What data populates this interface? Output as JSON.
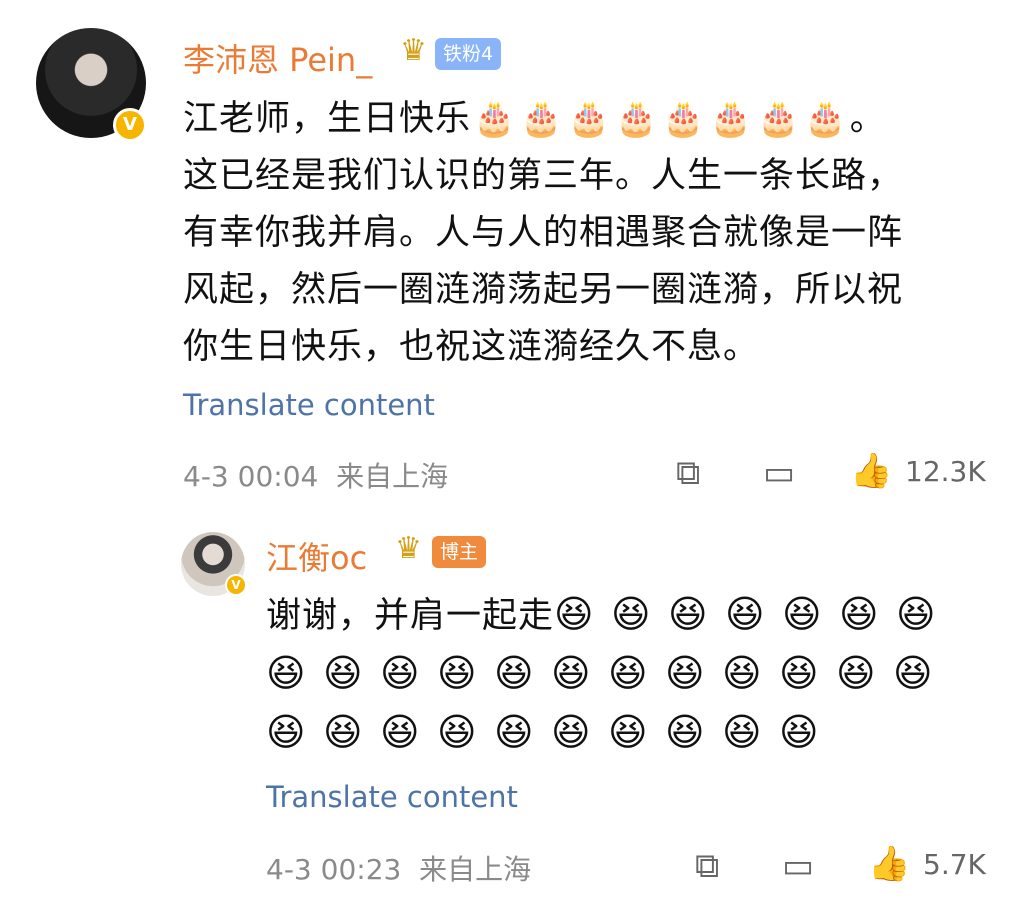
{
  "comment": {
    "username": "李沛恩 Pein_",
    "fan_badge": "铁粉4",
    "text_lines": [
      "这已经是我们认识的第三年。人生一条长路，",
      "有幸你我并肩。人与人的相遇聚合就像是一阵",
      "风起，然后一圈涟漪荡起另一圈涟漪，所以祝",
      "你生日快乐，也祝这涟漪经久不息。"
    ],
    "text_first": "江老师，生日快乐",
    "cake_count": 8,
    "text_first_end": "。",
    "translate": "Translate content",
    "timestamp": "4-3 00:04",
    "source": "来自上海",
    "like_count": "12.3K",
    "icons": {
      "share": "share-icon",
      "comment": "comment-icon",
      "like": "like-icon"
    }
  },
  "reply": {
    "username": "江衡oc",
    "host_badge": "博主",
    "text": "谢谢，并肩一起走",
    "laugh_count": 29,
    "translate": "Translate content",
    "timestamp": "4-3 00:23",
    "source": "来自上海",
    "like_count": "5.7K"
  },
  "colors": {
    "username": "#ea7b35",
    "link": "#4e73a6",
    "meta": "#8a8a8a",
    "verified": "#f7b500"
  }
}
